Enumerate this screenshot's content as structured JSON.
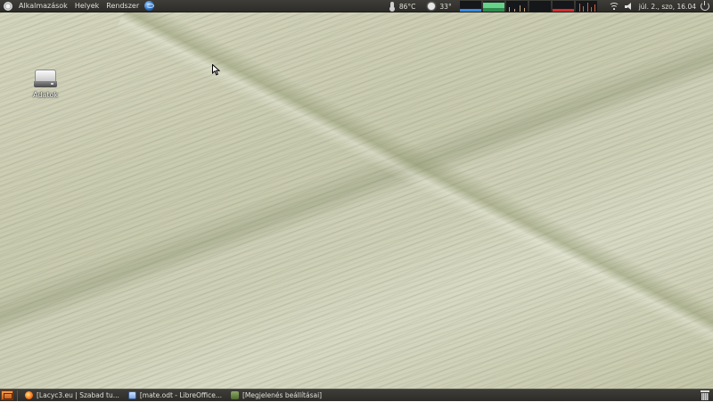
{
  "top_panel": {
    "menus": [
      {
        "label": "Alkalmazások"
      },
      {
        "label": "Helyek"
      },
      {
        "label": "Rendszer"
      }
    ],
    "temperature": "86°C",
    "weather": "33°",
    "clock": "júl. 2., szo, 16.04"
  },
  "desktop": {
    "icons": [
      {
        "label": "Adatok",
        "icon": "hard-drive-icon"
      }
    ]
  },
  "taskbar": {
    "tasks": [
      {
        "label": "[Lacyc3.eu | Szabad tu...",
        "icon": "firefox-icon"
      },
      {
        "label": "[mate.odt - LibreOffice...",
        "icon": "writer-document-icon"
      },
      {
        "label": "[Megjelenés beállításai]",
        "icon": "appearance-preferences-icon"
      }
    ]
  },
  "colors": {
    "panel_bg": "#2d2c28",
    "cpu_monitor": "#3b8be0",
    "mem_monitor": "#66d28a",
    "disk_monitor": "#d32f2f"
  }
}
